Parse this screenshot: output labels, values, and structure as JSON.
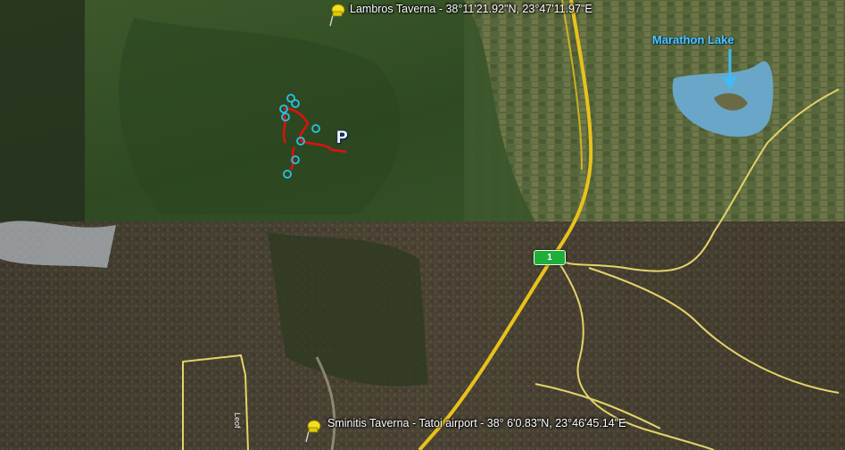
{
  "map": {
    "labels": {
      "lambros": "Lambros Taverna -  38°11'21.92\"N,  23°47'11.97\"E",
      "sminitis": "Sminitis Taverna - Tatoi airport - 38° 6'0.83\"N,  23°46'45.14\"E",
      "lake": "Marathon Lake",
      "street": "Leof"
    },
    "road_marker": "1",
    "parking_marker": "P",
    "colors": {
      "road_major": "#e8c21c",
      "road_minor": "#e3d36a",
      "route": "#e01010",
      "waypoint": "#27c4e6",
      "lake": "#6aa6c8",
      "pin": "#f2e020",
      "road_marker": "#1fae3a"
    },
    "icons": [
      "pushpin-icon",
      "parking-icon",
      "arrow-down-icon",
      "route-marker-icon"
    ]
  }
}
